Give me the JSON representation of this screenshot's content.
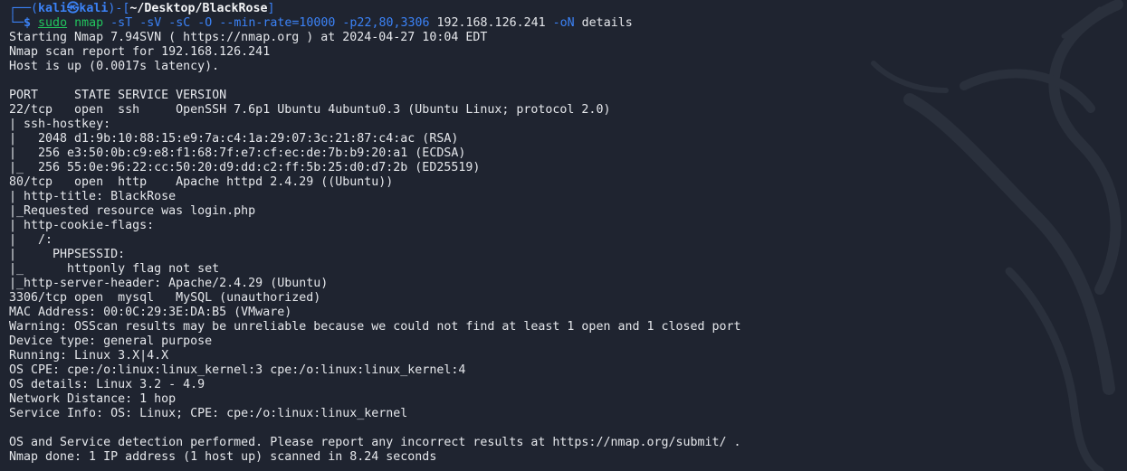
{
  "colors": {
    "background": "#1f2430",
    "text": "#e5e7eb",
    "prompt_accent": "#3b82f6",
    "command_green": "#22c55e"
  },
  "background_icon": "kali-dragon-icon",
  "prompt": {
    "corner_top": "┌──(",
    "user": "kali㉿kali",
    "bracket_mid": ")-[",
    "path": "~/Desktop/BlackRose",
    "bracket_end": "]",
    "corner_bottom": "└─",
    "symbol": "$"
  },
  "command": {
    "sudo": "sudo",
    "program": "nmap",
    "flags": [
      "-sT",
      "-sV",
      "-sC",
      "-O",
      "--min-rate=10000",
      "-p22,80,3306"
    ],
    "target": "192.168.126.241",
    "output_flag": "-oN",
    "output_file": "details"
  },
  "output_lines": [
    "Starting Nmap 7.94SVN ( https://nmap.org ) at 2024-04-27 10:04 EDT",
    "Nmap scan report for 192.168.126.241",
    "Host is up (0.0017s latency).",
    "",
    "PORT     STATE SERVICE VERSION",
    "22/tcp   open  ssh     OpenSSH 7.6p1 Ubuntu 4ubuntu0.3 (Ubuntu Linux; protocol 2.0)",
    "| ssh-hostkey: ",
    "|   2048 d1:9b:10:88:15:e9:7a:c4:1a:29:07:3c:21:87:c4:ac (RSA)",
    "|   256 e3:50:0b:c9:e8:f1:68:7f:e7:cf:ec:de:7b:b9:20:a1 (ECDSA)",
    "|_  256 55:0e:96:22:cc:50:20:d9:dd:c2:ff:5b:25:d0:d7:2b (ED25519)",
    "80/tcp   open  http    Apache httpd 2.4.29 ((Ubuntu))",
    "| http-title: BlackRose",
    "|_Requested resource was login.php",
    "| http-cookie-flags: ",
    "|   /: ",
    "|     PHPSESSID: ",
    "|_      httponly flag not set",
    "|_http-server-header: Apache/2.4.29 (Ubuntu)",
    "3306/tcp open  mysql   MySQL (unauthorized)",
    "MAC Address: 00:0C:29:3E:DA:B5 (VMware)",
    "Warning: OSScan results may be unreliable because we could not find at least 1 open and 1 closed port",
    "Device type: general purpose",
    "Running: Linux 3.X|4.X",
    "OS CPE: cpe:/o:linux:linux_kernel:3 cpe:/o:linux:linux_kernel:4",
    "OS details: Linux 3.2 - 4.9",
    "Network Distance: 1 hop",
    "Service Info: OS: Linux; CPE: cpe:/o:linux:linux_kernel",
    "",
    "OS and Service detection performed. Please report any incorrect results at https://nmap.org/submit/ .",
    "Nmap done: 1 IP address (1 host up) scanned in 8.24 seconds"
  ]
}
